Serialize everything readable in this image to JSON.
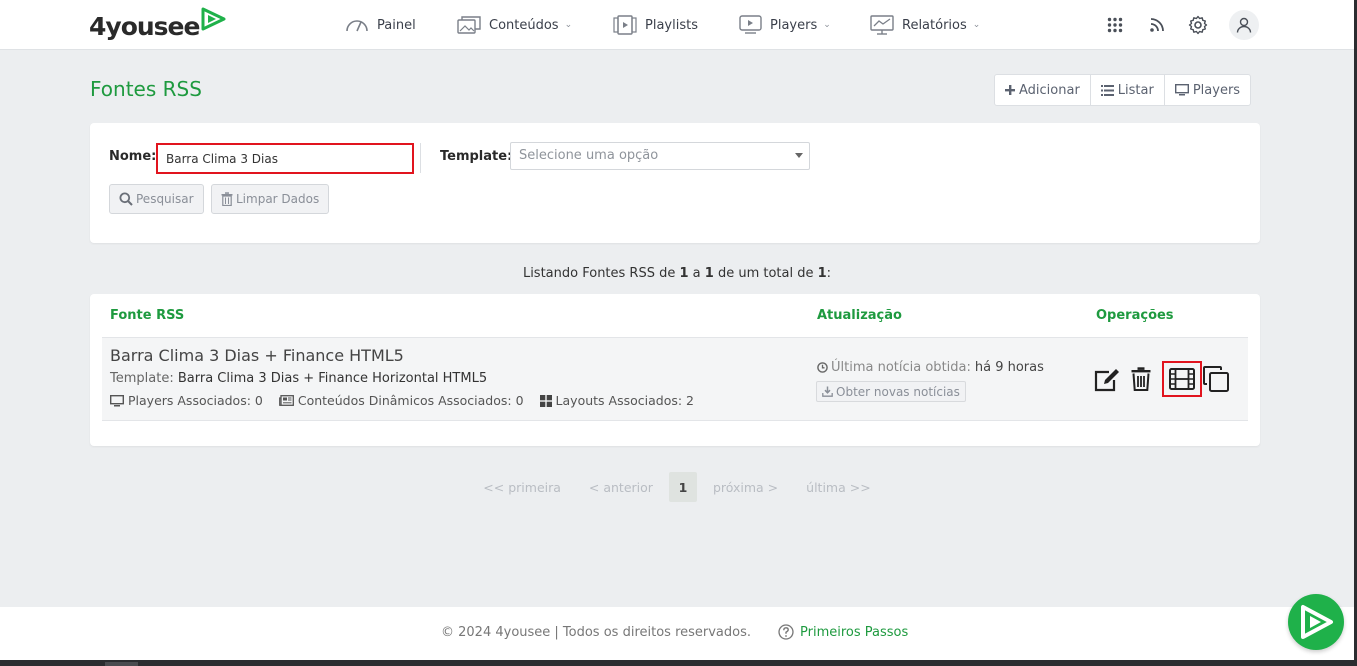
{
  "brand": {
    "name": "4yousee",
    "accent": "#1e9a3f",
    "highlight": "#e1141e"
  },
  "nav": {
    "items": [
      {
        "label": "Painel",
        "icon": "gauge-icon",
        "dropdown": false
      },
      {
        "label": "Conteúdos",
        "icon": "images-icon",
        "dropdown": true
      },
      {
        "label": "Playlists",
        "icon": "playlist-icon",
        "dropdown": false
      },
      {
        "label": "Players",
        "icon": "player-icon",
        "dropdown": true
      },
      {
        "label": "Relatórios",
        "icon": "reports-icon",
        "dropdown": true
      }
    ],
    "right_icons": [
      "apps-grid-icon",
      "rss-icon",
      "gear-icon",
      "user-icon"
    ]
  },
  "page": {
    "title": "Fontes RSS",
    "actions": {
      "add": "Adicionar",
      "list": "Listar",
      "players": "Players"
    }
  },
  "filters": {
    "name_label": "Nome:",
    "name_value": "Barra Clima 3 Dias",
    "template_label": "Template:",
    "template_placeholder": "Selecione uma opção",
    "search_button": "Pesquisar",
    "clear_button": "Limpar Dados"
  },
  "listing": {
    "prefix": "Listando Fontes RSS de ",
    "from": "1",
    "mid": " a ",
    "to": "1",
    "mid2": " de um total de ",
    "total": "1",
    "suffix": ":"
  },
  "table": {
    "headers": {
      "source": "Fonte RSS",
      "update": "Atualização",
      "operations": "Operações"
    },
    "rows": [
      {
        "title": "Barra Clima 3 Dias + Finance HTML5",
        "template_label": "Template:",
        "template_value": "Barra Clima 3 Dias + Finance Horizontal HTML5",
        "players": "Players Associados: 0",
        "dynamic": "Conteúdos Dinâmicos Associados: 0",
        "layouts": "Layouts Associados: 2",
        "last_news_label": "Última notícia obtida:",
        "last_news_value": "há 9 horas",
        "fetch_button": "Obter novas notícias",
        "operations": [
          "edit-icon",
          "trash-icon",
          "film-icon",
          "copy-icon"
        ]
      }
    ]
  },
  "pagination": {
    "first": "<< primeira",
    "prev": "< anterior",
    "current": "1",
    "next": "próxima >",
    "last": "última >>"
  },
  "footer": {
    "copyright": "© 2024 4yousee | Todos os direitos reservados.",
    "help_link": "Primeiros Passos"
  }
}
